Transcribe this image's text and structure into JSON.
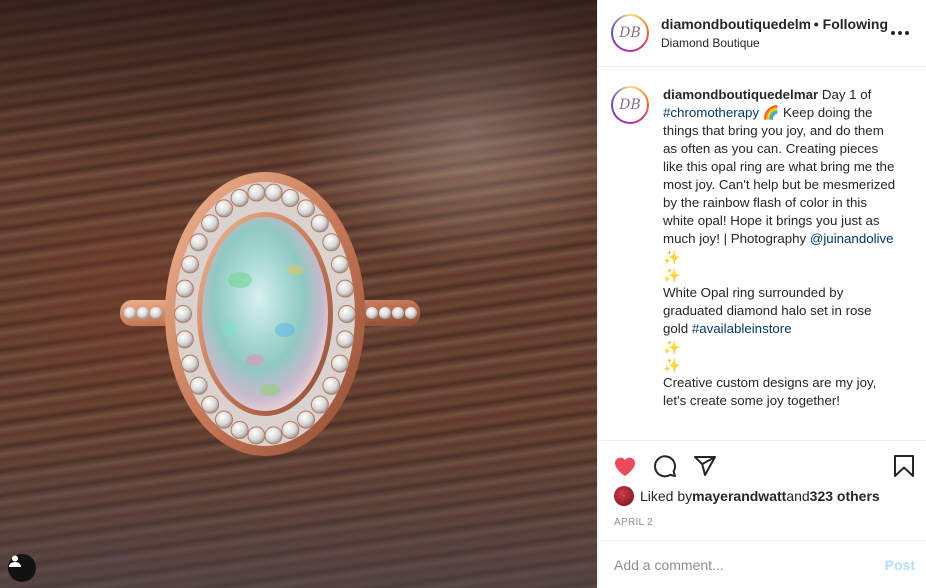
{
  "post": {
    "photo_alt": "Opal ring with diamond halo in rose gold",
    "header": {
      "username": "diamondboutiquedelm",
      "separator": "•",
      "follow_status": "Following",
      "location": "Diamond Boutique",
      "avatar_initials": "DB",
      "more_icon": "more-horizontal-icon"
    },
    "caption": {
      "username": "diamondboutiquedelmar",
      "segments": [
        {
          "type": "text",
          "text": " Day 1 of "
        },
        {
          "type": "link",
          "text": "#chromotherapy"
        },
        {
          "type": "text",
          "text": " 🌈 Keep doing the things that bring you joy, and do them as often as you can. Creating pieces like this opal ring are what bring me the most joy. Can't help but be mesmerized by the rainbow flash of color in this white opal! Hope it brings you just as much joy! | Photography "
        },
        {
          "type": "link",
          "text": "@juinandolive"
        }
      ],
      "sparkle_1": "✨",
      "sparkle_2": "✨",
      "line2_text": "White Opal ring surrounded by graduated diamond halo set in rose gold ",
      "line2_link": "#availableinstore",
      "sparkle_3": "✨",
      "sparkle_4": "✨",
      "line3_text": "Creative custom designs are my joy, let's create some joy together!"
    },
    "actions": {
      "like_icon": "heart-filled-icon",
      "comment_icon": "comment-icon",
      "share_icon": "share-icon",
      "save_icon": "bookmark-icon",
      "like_color": "#ed4956"
    },
    "likes": {
      "prefix": "Liked by ",
      "user": "mayerandwatt",
      "middle": " and ",
      "others": "323 others"
    },
    "date": "APRIL 2",
    "comment": {
      "placeholder": "Add a comment...",
      "post_label": "Post"
    }
  }
}
